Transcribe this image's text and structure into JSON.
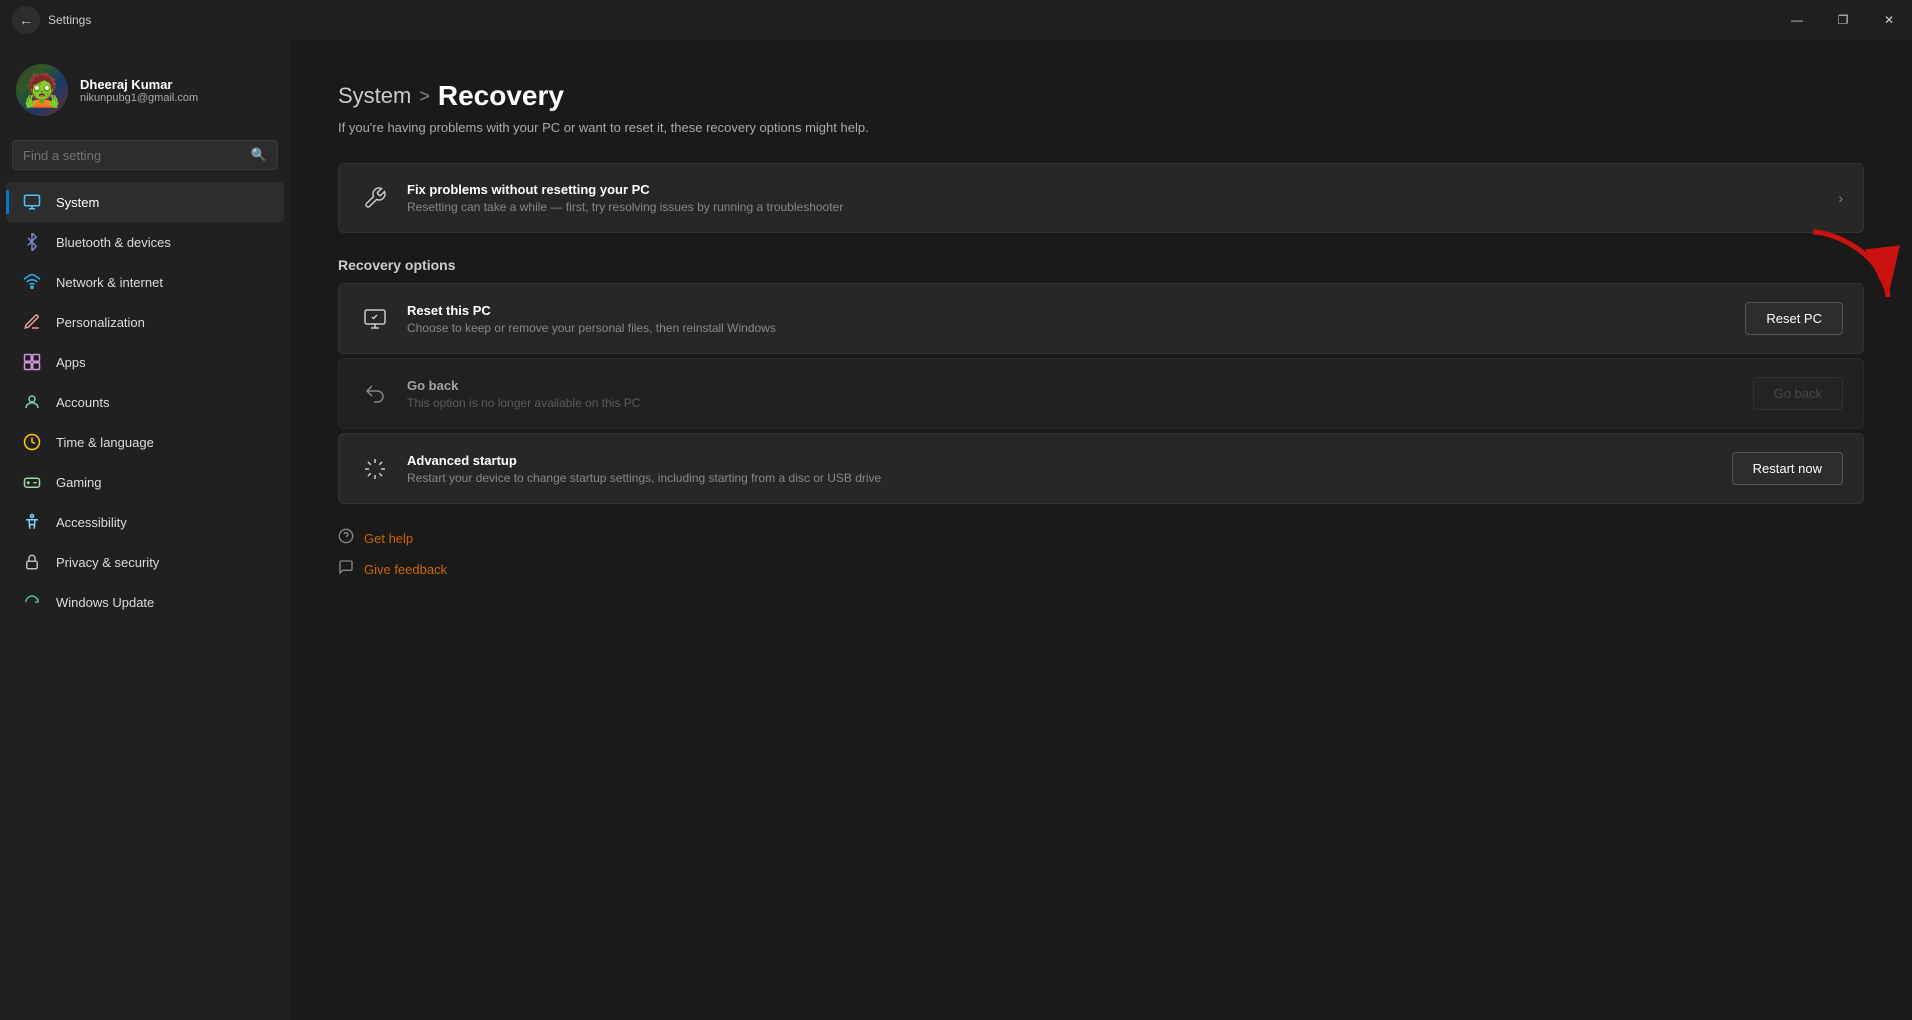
{
  "titlebar": {
    "title": "Settings",
    "minimize": "—",
    "restore": "❐",
    "close": "✕"
  },
  "sidebar": {
    "search_placeholder": "Find a setting",
    "user": {
      "name": "Dheeraj Kumar",
      "email": "nikunpubg1@gmail.com",
      "avatar_emoji": "🧟"
    },
    "nav_items": [
      {
        "id": "system",
        "label": "System",
        "icon": "💻",
        "active": true
      },
      {
        "id": "bluetooth",
        "label": "Bluetooth & devices",
        "icon": "📶"
      },
      {
        "id": "network",
        "label": "Network & internet",
        "icon": "🌐"
      },
      {
        "id": "personalization",
        "label": "Personalization",
        "icon": "✏️"
      },
      {
        "id": "apps",
        "label": "Apps",
        "icon": "📦"
      },
      {
        "id": "accounts",
        "label": "Accounts",
        "icon": "👤"
      },
      {
        "id": "time",
        "label": "Time & language",
        "icon": "🕐"
      },
      {
        "id": "gaming",
        "label": "Gaming",
        "icon": "🎮"
      },
      {
        "id": "accessibility",
        "label": "Accessibility",
        "icon": "♿"
      },
      {
        "id": "privacy",
        "label": "Privacy & security",
        "icon": "🔒"
      },
      {
        "id": "update",
        "label": "Windows Update",
        "icon": "🔄"
      }
    ]
  },
  "content": {
    "breadcrumb_parent": "System",
    "breadcrumb_separator": ">",
    "breadcrumb_current": "Recovery",
    "description": "If you're having problems with your PC or want to reset it, these recovery options might help.",
    "fix_option": {
      "title": "Fix problems without resetting your PC",
      "description": "Resetting can take a while — first, try resolving issues by running a troubleshooter"
    },
    "section_title": "Recovery options",
    "recovery_options": [
      {
        "id": "reset",
        "title": "Reset this PC",
        "description": "Choose to keep or remove your personal files, then reinstall Windows",
        "button_label": "Reset PC",
        "disabled": false
      },
      {
        "id": "goback",
        "title": "Go back",
        "description": "This option is no longer available on this PC",
        "button_label": "Go back",
        "disabled": true
      },
      {
        "id": "advanced",
        "title": "Advanced startup",
        "description": "Restart your device to change startup settings, including starting from a disc or USB drive",
        "button_label": "Restart now",
        "disabled": false
      }
    ],
    "links": [
      {
        "id": "help",
        "label": "Get help"
      },
      {
        "id": "feedback",
        "label": "Give feedback"
      }
    ]
  }
}
